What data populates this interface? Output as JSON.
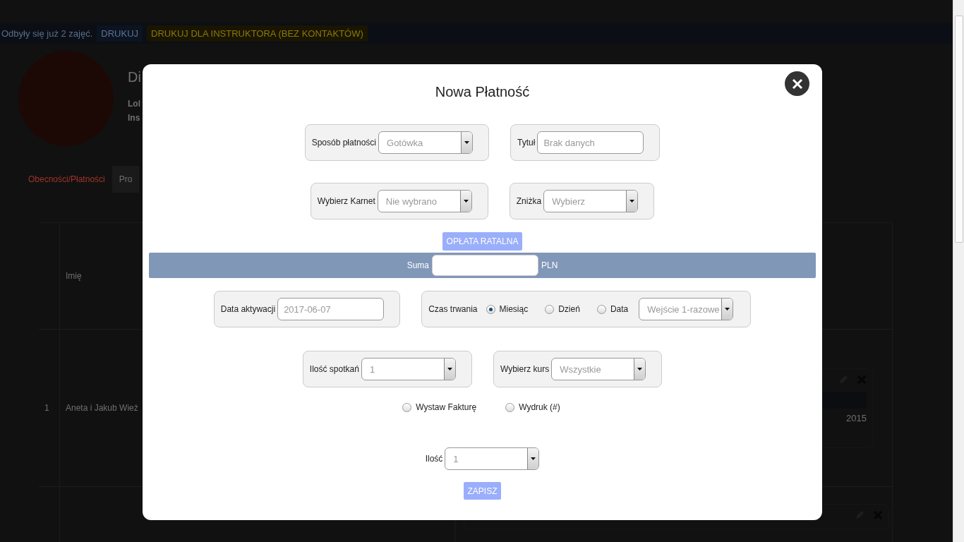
{
  "background": {
    "notice": "Odbyły się już 2 zajęć.",
    "print_button": "DRUKUJ",
    "print_instructor_button": "DRUKUJ DLA INSTRUKTORA (BEZ KONTAKTÓW)",
    "heading": "Di",
    "info_lines": [
      "Lol",
      "Ins"
    ],
    "tabs": [
      {
        "label": "Obecności/Płatności",
        "selected": true
      },
      {
        "label": "Pro",
        "selected": false
      }
    ],
    "table_header": "Imię",
    "rows": [
      {
        "number": "1",
        "name": "Aneta i Jakub Wież",
        "card_text": "2015"
      }
    ]
  },
  "modal": {
    "title": "Nowa Płatność",
    "top_rows": [
      [
        {
          "kind": "select",
          "label": "Sposób płatności",
          "value": "Gotówka"
        },
        {
          "kind": "input",
          "label": "Tytuł",
          "placeholder": "Brak danych"
        }
      ],
      [
        {
          "kind": "select",
          "label": "Wybierz Karnet",
          "value": "Nie wybrano"
        },
        {
          "kind": "select",
          "label": "Zniżka",
          "value": "Wybierz"
        }
      ]
    ],
    "installment_button": "OPŁATA RATALNA",
    "sum": {
      "label": "Suma",
      "currency": "PLN"
    },
    "bottom_rows": [
      [
        {
          "kind": "input",
          "label": "Data aktywacji",
          "placeholder": "2017-06-07"
        },
        {
          "kind": "duration",
          "label": "Czas trwania",
          "options": [
            {
              "label": "Miesiąc",
              "selected": true
            },
            {
              "label": "Dzień",
              "selected": false
            },
            {
              "label": "Data",
              "selected": false
            }
          ],
          "value": "Wejście 1-razowe"
        }
      ],
      [
        {
          "kind": "select",
          "label": "Ilość spotkań",
          "value": "1"
        },
        {
          "kind": "select",
          "label": "Wybierz kurs",
          "value": "Wszystkie"
        }
      ]
    ],
    "invoice_options": [
      {
        "label": "Wystaw Fakturę",
        "selected": false
      },
      {
        "label": "Wydruk (#)",
        "selected": false
      }
    ],
    "quantity": {
      "label": "Ilość",
      "value": "1"
    },
    "save_button": "ZAPISZ"
  }
}
